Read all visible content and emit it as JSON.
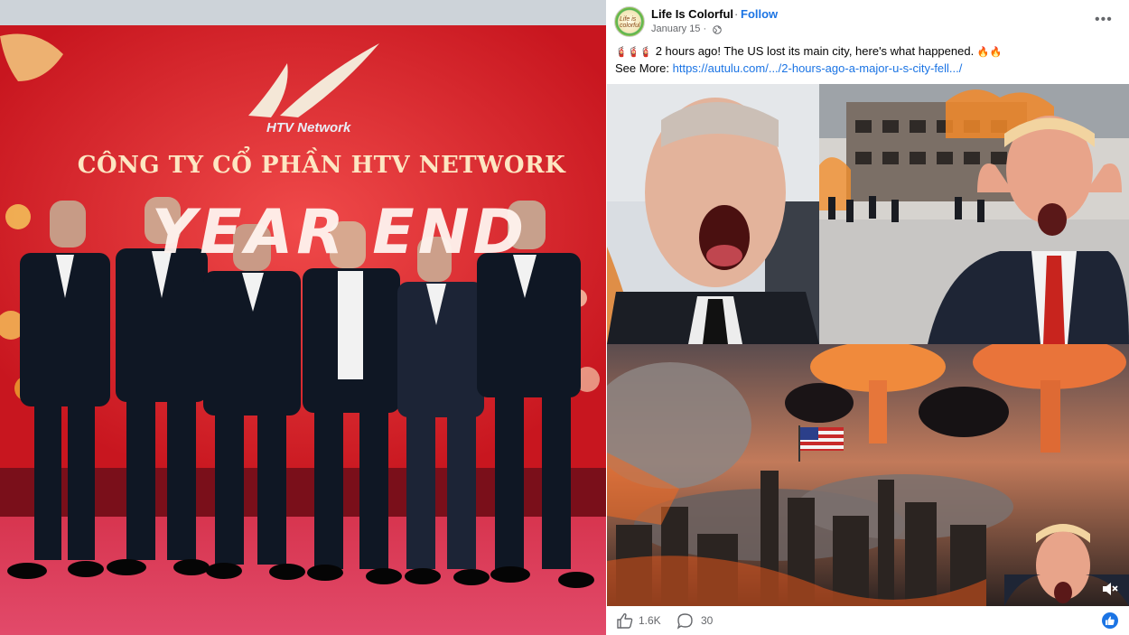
{
  "left_photo": {
    "logo_text": "HTV Network",
    "company_name": "CÔNG TY CỔ PHẦN HTV NETWORK",
    "banner_text": "YEAR END"
  },
  "post": {
    "page_name": "Life Is Colorful",
    "follow_separator": "·",
    "follow_label": "Follow",
    "date": "January 15 ·",
    "avatar_text": "Life is colorful",
    "emoji_prefix": "🧯🧯🧯",
    "headline": "2 hours ago! The US lost its main city, here's what happened.",
    "emoji_suffix": "🔥🔥",
    "see_more_label": "See More:",
    "link_text": "https://autulu.com/.../2-hours-ago-a-major-u-s-city-fell.../",
    "more_icon": "more-horizontal-icon",
    "footer": {
      "like_count": "1.6K",
      "comment_count": "30"
    },
    "colors": {
      "accent": "#1b74e4",
      "secondary_text": "#65676b"
    }
  }
}
